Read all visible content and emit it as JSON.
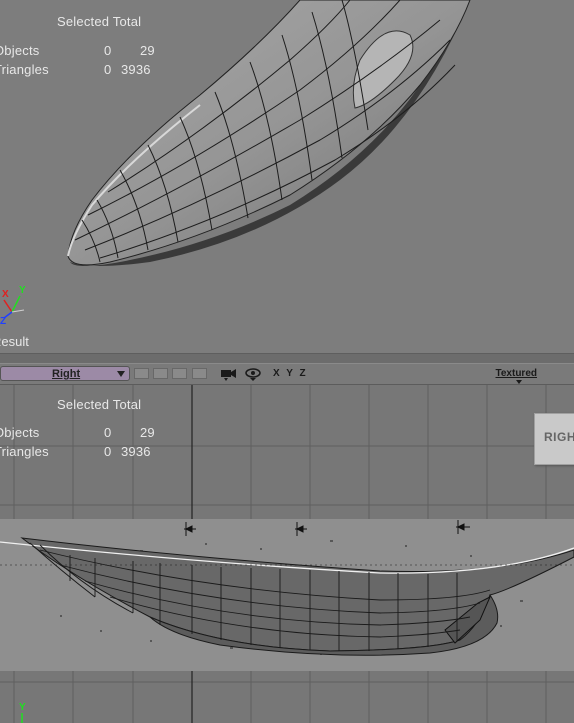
{
  "perspective_view": {
    "stats": {
      "col_selected": "Selected",
      "col_total": "Total",
      "rows": [
        {
          "label": "Objects",
          "selected": "0",
          "total": "29"
        },
        {
          "label": "Triangles",
          "selected": "0",
          "total": "3936"
        }
      ]
    },
    "axis": {
      "x": "X",
      "y": "Y",
      "z": "Z"
    },
    "label": "Result"
  },
  "toolbar": {
    "view_select": "Right",
    "axes_label": "X Y Z",
    "shading": "Textured"
  },
  "ortho_view": {
    "stats": {
      "col_selected": "Selected",
      "col_total": "Total",
      "rows": [
        {
          "label": "Objects",
          "selected": "0",
          "total": "29"
        },
        {
          "label": "Triangles",
          "selected": "0",
          "total": "3936"
        }
      ]
    },
    "view_badge": "RIGHT",
    "axis": {
      "y": "Y"
    }
  },
  "colors": {
    "viewport_bg": "#7d7d7d",
    "view_select_bg": "#9c8aa6",
    "axis_x": "#e02020",
    "axis_y": "#20e020",
    "axis_z": "#2040ff"
  }
}
